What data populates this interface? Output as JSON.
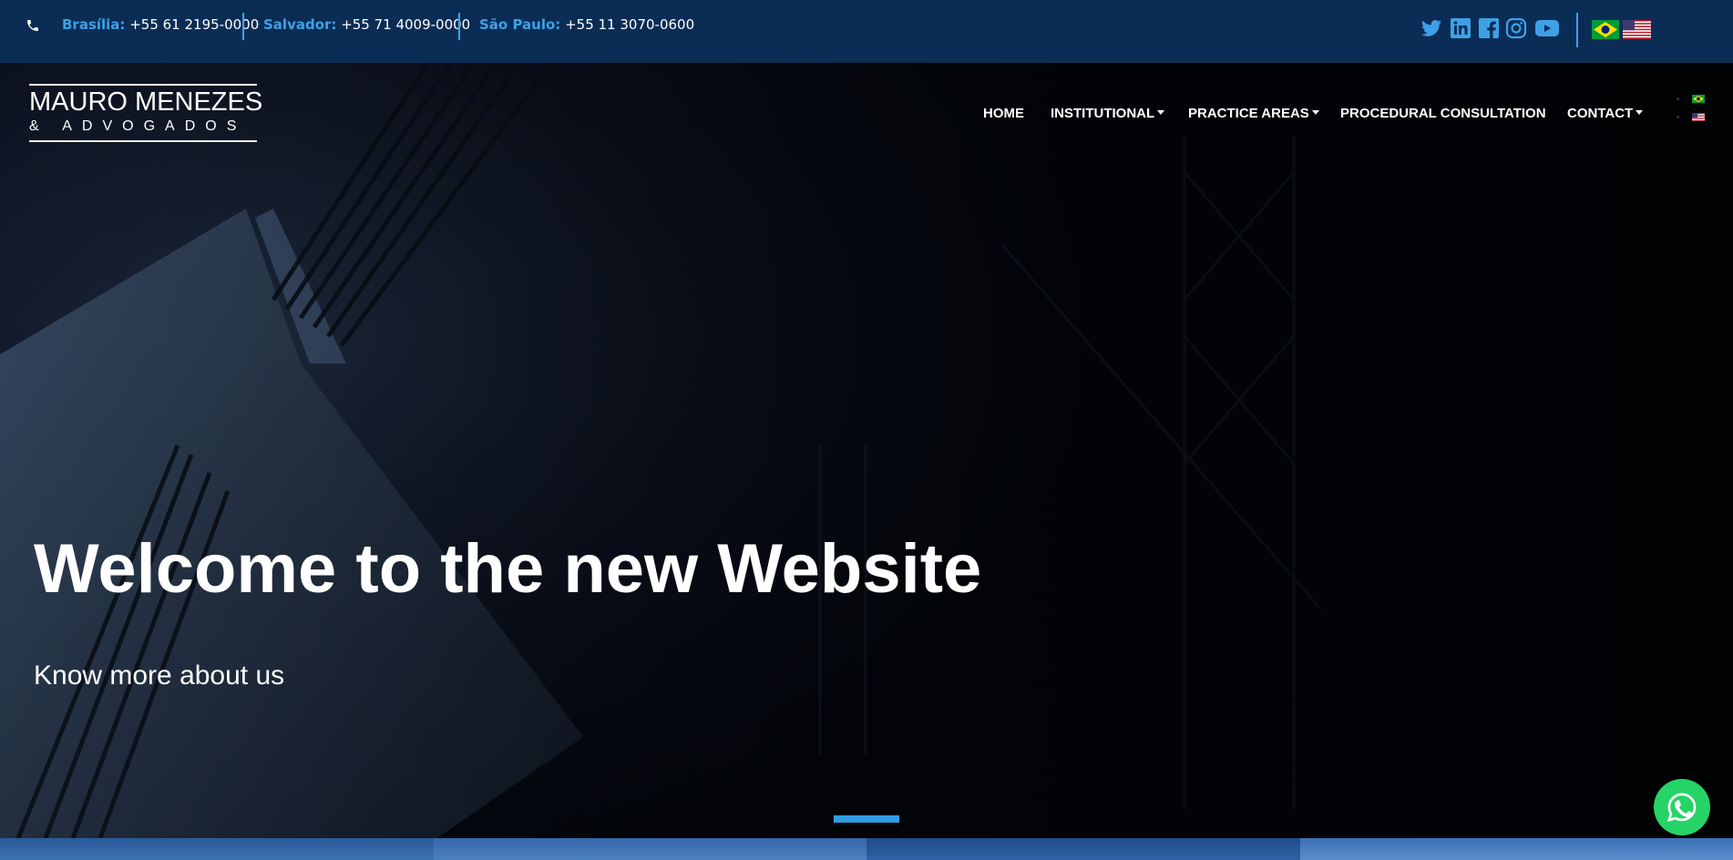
{
  "topbar": {
    "contacts": [
      {
        "city": "Brasília:",
        "number": "+55 61 2195-0000"
      },
      {
        "city": "Salvador:",
        "number": "+55 71 4009-0000"
      },
      {
        "city": "São Paulo:",
        "number": "+55 11 3070-0600"
      }
    ],
    "social": [
      "twitter-icon",
      "linkedin-icon",
      "facebook-icon",
      "instagram-icon",
      "youtube-icon"
    ],
    "languages": [
      "brazil-flag",
      "usa-flag"
    ]
  },
  "logo": {
    "line1": "MAURO MENEZES",
    "line2": "& ADVOGADOS"
  },
  "nav": {
    "home": "HOME",
    "institutional": "INSTITUTIONAL",
    "practice_areas": "PRACTICE AREAS",
    "procedural": "PROCEDURAL CONSULTATION",
    "contact": "CONTACT"
  },
  "hero": {
    "title": "Welcome to the new Website",
    "subtitle": "Know more about us"
  },
  "colors": {
    "topbar": "#0b2d55",
    "accent": "#3fa0e6",
    "whatsapp": "#25d366"
  }
}
